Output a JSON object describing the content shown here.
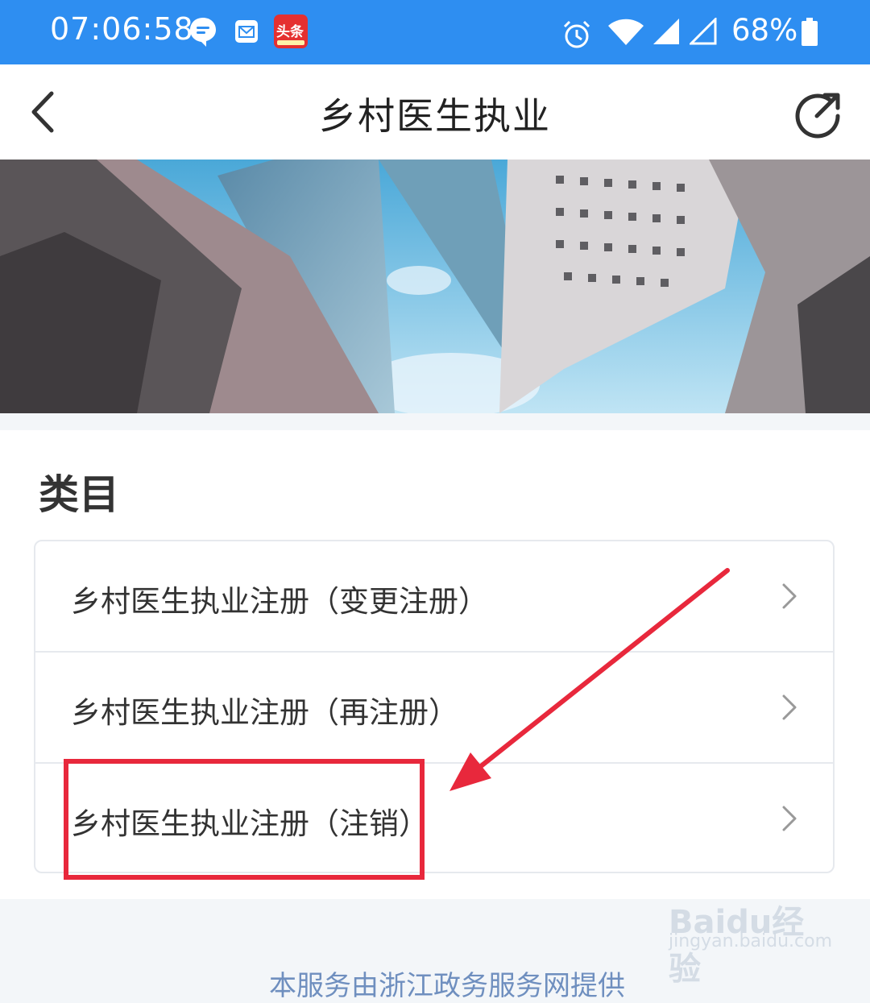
{
  "status_bar": {
    "time": "07:06:58",
    "battery": "68%",
    "icons": [
      "chat-icon",
      "mail-icon",
      "toutiao-app-icon",
      "alarm-icon",
      "wifi-icon",
      "signal-icon",
      "signal-icon",
      "battery-icon"
    ],
    "toutiao_label": "头条"
  },
  "nav": {
    "title": "乡村医生执业",
    "back_icon": "back-chevron-icon",
    "share_icon": "share-icon"
  },
  "section": {
    "heading": "类目",
    "items": [
      {
        "label": "乡村医生执业注册（变更注册）"
      },
      {
        "label": "乡村医生执业注册（再注册）"
      },
      {
        "label": "乡村医生执业注册（注销）"
      }
    ]
  },
  "footer": {
    "partial_text": "本服务由浙江政务服务网提供"
  },
  "watermark": {
    "brand": "Baidu经验",
    "url": "jingyan.baidu.com"
  },
  "colors": {
    "status_bar": "#2e8ef1",
    "annotation": "#e8283c"
  }
}
